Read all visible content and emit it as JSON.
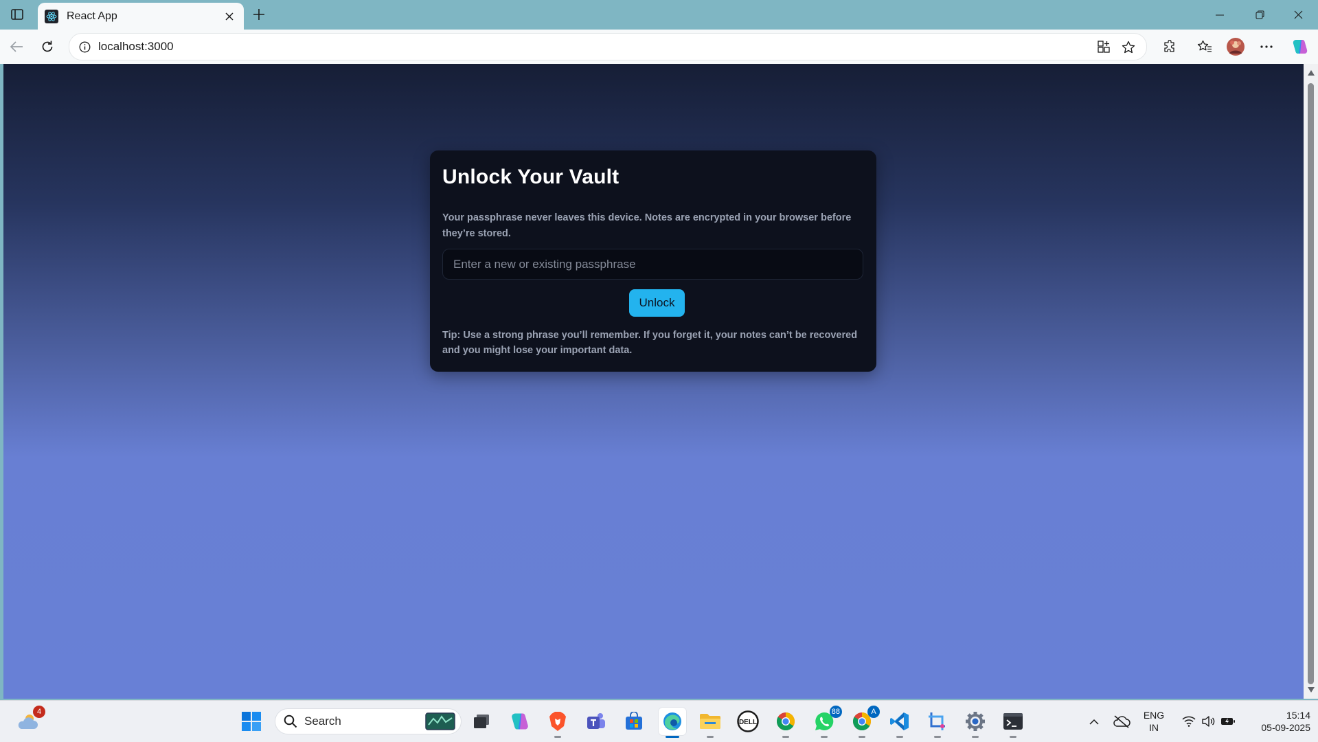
{
  "browser": {
    "tab_title": "React App",
    "url": "localhost:3000"
  },
  "vault": {
    "title": "Unlock Your Vault",
    "description": "Your passphrase never leaves this device. Notes are encrypted in your browser before they’re stored.",
    "passphrase_placeholder": "Enter a new or existing passphrase",
    "passphrase_value": "",
    "unlock_label": "Unlock",
    "tip": "Tip: Use a strong phrase you’ll remember. If you forget it, your notes can’t be recovered and you might lose your important data."
  },
  "colors": {
    "card_bg": "#0d111d",
    "button_bg": "#23b3ee",
    "gradient_top": "#161e36",
    "gradient_bottom": "#6880d6"
  },
  "taskbar": {
    "weather_badge": "4",
    "search_label": "Search",
    "whatsapp_badge": "88",
    "chrome_badge": "A",
    "language_line1": "ENG",
    "language_line2": "IN",
    "time": "15:14",
    "date": "05-09-2025",
    "icons": [
      "weather-icon",
      "windows-start-icon",
      "search-icon",
      "task-view-icon",
      "copilot-icon",
      "brave-icon",
      "teams-icon",
      "store-icon",
      "edge-icon",
      "file-explorer-icon",
      "dell-icon",
      "chrome-icon",
      "whatsapp-icon",
      "chrome-profile-icon",
      "vscode-icon",
      "snipping-tool-icon",
      "settings-icon",
      "terminal-icon"
    ]
  }
}
